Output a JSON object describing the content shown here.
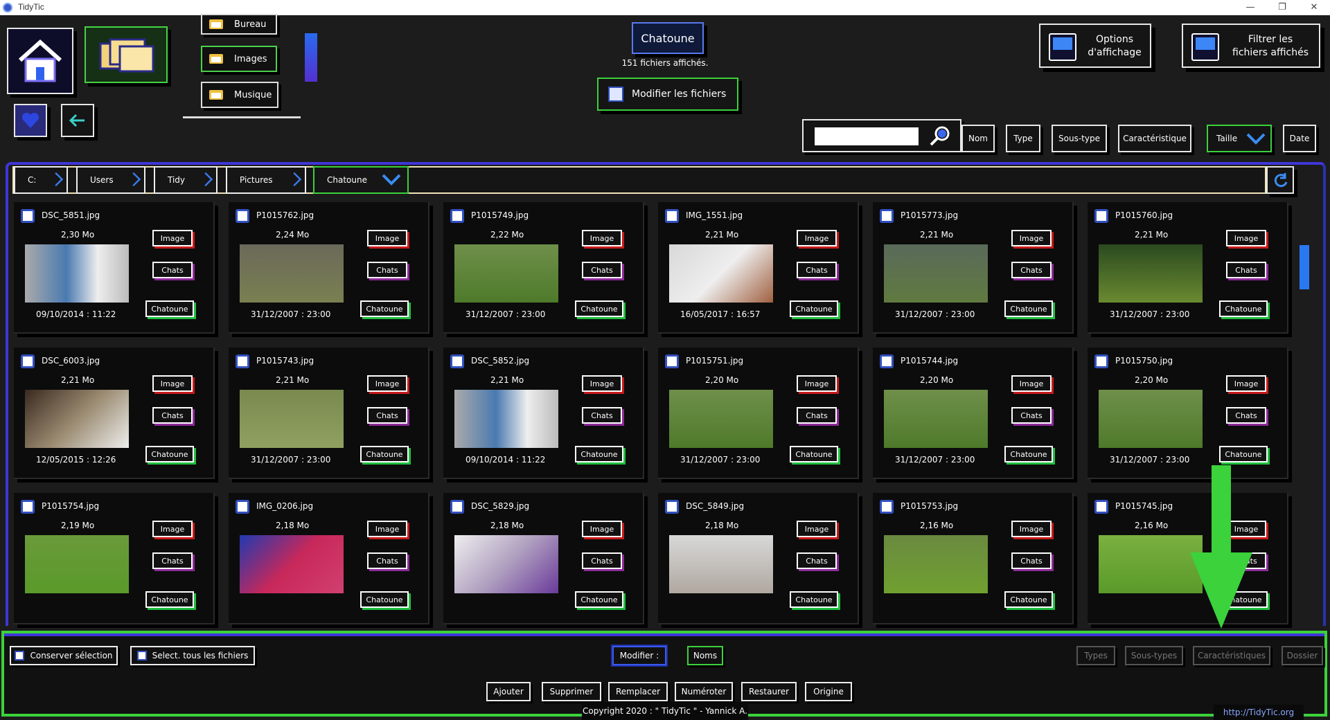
{
  "window": {
    "title": "TidyTic",
    "min": "—",
    "max": "❐",
    "close": "✕"
  },
  "header": {
    "folders": [
      "Bureau",
      "Images",
      "Musique"
    ],
    "current_folder": "Chatoune",
    "file_count": "151 fichiers affichés.",
    "modify_label": "Modifier les fichiers",
    "options_label": "Options\nd'affichage",
    "filter_label": "Filtrer les\nfichiers affichés"
  },
  "search": {
    "value": ""
  },
  "sort": [
    "Nom",
    "Type",
    "Sous-type",
    "Caractéristique",
    "Taille",
    "Date"
  ],
  "breadcrumb": [
    "C:",
    "Users",
    "Tidy",
    "Pictures",
    "Chatoune"
  ],
  "tags": {
    "type": "Image",
    "subtype": "Chats",
    "folder": "Chatoune"
  },
  "files": [
    {
      "name": "DSC_5851.jpg",
      "size": "2,30 Mo",
      "date": "09/10/2014 : 11:22"
    },
    {
      "name": "P1015762.jpg",
      "size": "2,24 Mo",
      "date": "31/12/2007 : 23:00"
    },
    {
      "name": "P1015749.jpg",
      "size": "2,22 Mo",
      "date": "31/12/2007 : 23:00"
    },
    {
      "name": "IMG_1551.jpg",
      "size": "2,21 Mo",
      "date": "16/05/2017 : 16:57"
    },
    {
      "name": "P1015773.jpg",
      "size": "2,21 Mo",
      "date": "31/12/2007 : 23:00"
    },
    {
      "name": "P1015760.jpg",
      "size": "2,21 Mo",
      "date": "31/12/2007 : 23:00"
    },
    {
      "name": "DSC_6003.jpg",
      "size": "2,21 Mo",
      "date": "12/05/2015 : 12:26"
    },
    {
      "name": "P1015743.jpg",
      "size": "2,21 Mo",
      "date": "31/12/2007 : 23:00"
    },
    {
      "name": "DSC_5852.jpg",
      "size": "2,21 Mo",
      "date": "09/10/2014 : 11:22"
    },
    {
      "name": "P1015751.jpg",
      "size": "2,20 Mo",
      "date": "31/12/2007 : 23:00"
    },
    {
      "name": "P1015744.jpg",
      "size": "2,20 Mo",
      "date": "31/12/2007 : 23:00"
    },
    {
      "name": "P1015750.jpg",
      "size": "2,20 Mo",
      "date": "31/12/2007 : 23:00"
    },
    {
      "name": "P1015754.jpg",
      "size": "2,19 Mo",
      "date": ""
    },
    {
      "name": "IMG_0206.jpg",
      "size": "2,18 Mo",
      "date": ""
    },
    {
      "name": "DSC_5829.jpg",
      "size": "2,18 Mo",
      "date": ""
    },
    {
      "name": "DSC_5849.jpg",
      "size": "2,18 Mo",
      "date": ""
    },
    {
      "name": "P1015753.jpg",
      "size": "2,16 Mo",
      "date": ""
    },
    {
      "name": "P1015745.jpg",
      "size": "2,16 Mo",
      "date": ""
    }
  ],
  "bottom": {
    "keep_selection": "Conserver sélection",
    "select_all": "Select. tous les fichiers",
    "modify": "Modifier :",
    "names": "Noms",
    "types": "Types",
    "subtypes": "Sous-types",
    "characteristics": "Caractéristiques",
    "folder": "Dossier",
    "actions": [
      "Ajouter",
      "Supprimer",
      "Remplacer",
      "Numéroter",
      "Restaurer",
      "Origine"
    ]
  },
  "footer": {
    "copyright": "Copyright 2020 : \" TidyTic \" - Yannick A.",
    "url": "http://TidyTic.org"
  },
  "colors": {
    "accent_blue": "#3f36d8",
    "accent_green": "#3bd23b",
    "tag_red": "#c81a1a",
    "tag_purple": "#8e2a9a"
  }
}
